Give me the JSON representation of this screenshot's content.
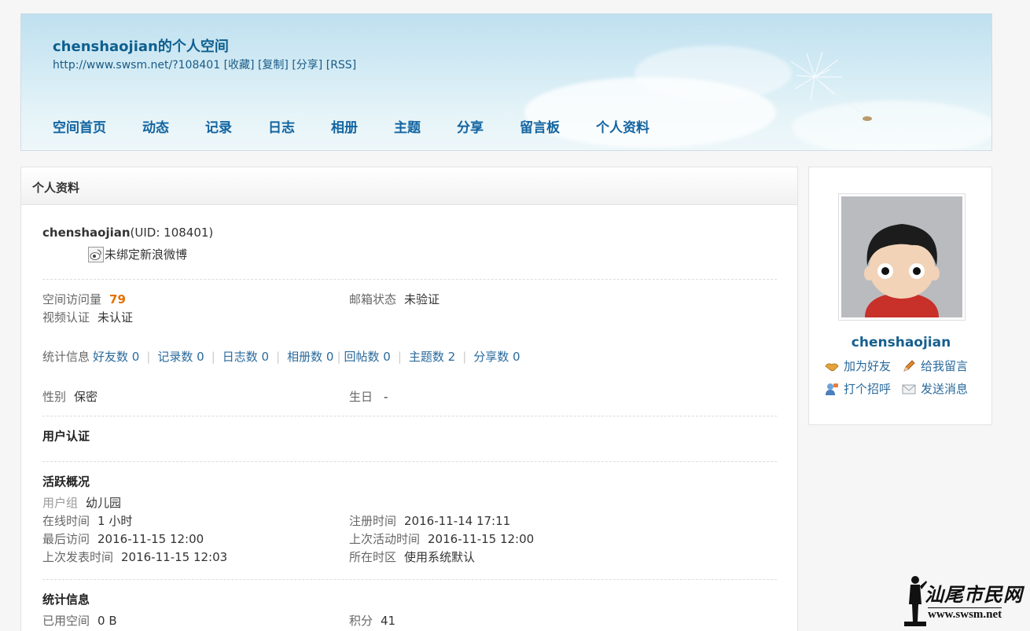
{
  "header": {
    "site_title": "chenshaojian的个人空间",
    "url": "http://www.swsm.net/?108401",
    "links": [
      "[收藏]",
      "[复制]",
      "[分享]",
      "[RSS]"
    ],
    "nav": [
      "空间首页",
      "动态",
      "记录",
      "日志",
      "相册",
      "主题",
      "分享",
      "留言板",
      "个人资料"
    ]
  },
  "main": {
    "panel_title": "个人资料",
    "username": "chenshaojian",
    "uid_text": "(UID: 108401)",
    "weibo_status": "未绑定新浪微博",
    "visits_label": "空间访问量",
    "visits_value": "79",
    "email_label": "邮箱状态",
    "email_value": "未验证",
    "video_label": "视频认证",
    "video_value": "未认证",
    "stats_label": "统计信息",
    "stats": [
      "好友数 0",
      "记录数 0",
      "日志数 0",
      "相册数 0",
      "回帖数 0",
      "主题数 2",
      "分享数 0"
    ],
    "gender_label": "性别",
    "gender_value": "保密",
    "birthday_label": "生日",
    "birthday_value": "-",
    "cert_heading": "用户认证",
    "activity_heading": "活跃概况",
    "usergroup_label": "用户组",
    "usergroup_value": "幼儿园",
    "online_label": "在线时间",
    "online_value": "1 小时",
    "register_label": "注册时间",
    "register_value": "2016-11-14 17:11",
    "lastvisit_label": "最后访问",
    "lastvisit_value": "2016-11-15 12:00",
    "lastactive_label": "上次活动时间",
    "lastactive_value": "2016-11-15 12:00",
    "lastpost_label": "上次发表时间",
    "lastpost_value": "2016-11-15 12:03",
    "timezone_label": "所在时区",
    "timezone_value": "使用系统默认",
    "stats_heading": "统计信息",
    "space_label": "已用空间",
    "space_value": "0 B",
    "points_label": "积分",
    "points_value": "41"
  },
  "sidebar": {
    "username": "chenshaojian",
    "actions": [
      "加为好友",
      "给我留言",
      "打个招呼",
      "发送消息"
    ]
  },
  "watermark": {
    "text_cn": "汕尾市民网",
    "text_url": "www.swsm.net"
  }
}
